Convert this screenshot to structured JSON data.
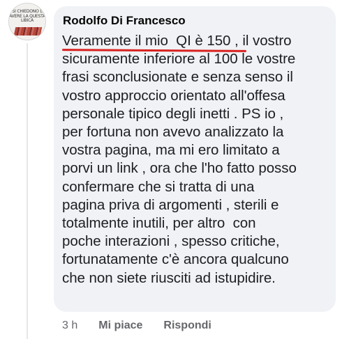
{
  "comment": {
    "avatar_text": "SI CHIEDONO L\nAVERE LA QUESTA\nLIBICA",
    "author": "Rodolfo Di Francesco",
    "text": "Veramente il mio  QI è 150 , il vostro\nsicuramente inferiore al 100 le vostre\nfrasi sconclusionate e senza senso il\nvostro approccio orientato all'offesa\npersonale tipico degli inetti . PS io ,\nper fortuna non avevo analizzato la\nvostra pagina, ma mi ero limitato a\nporvi un link , ora che l'ho fatto posso\nconfermare che si tratta di una\npagina priva di argomenti , sterili e\ntotalmente inutili, per altro  con\npoche interazioni , spesso critiche,\nfortunatamente c'è ancora qualcuno\nche non siete riusciti ad istupidire.",
    "time": "3 h",
    "like_label": "Mi piace",
    "reply_label": "Rispondi",
    "underline_color": "#d9211f"
  }
}
